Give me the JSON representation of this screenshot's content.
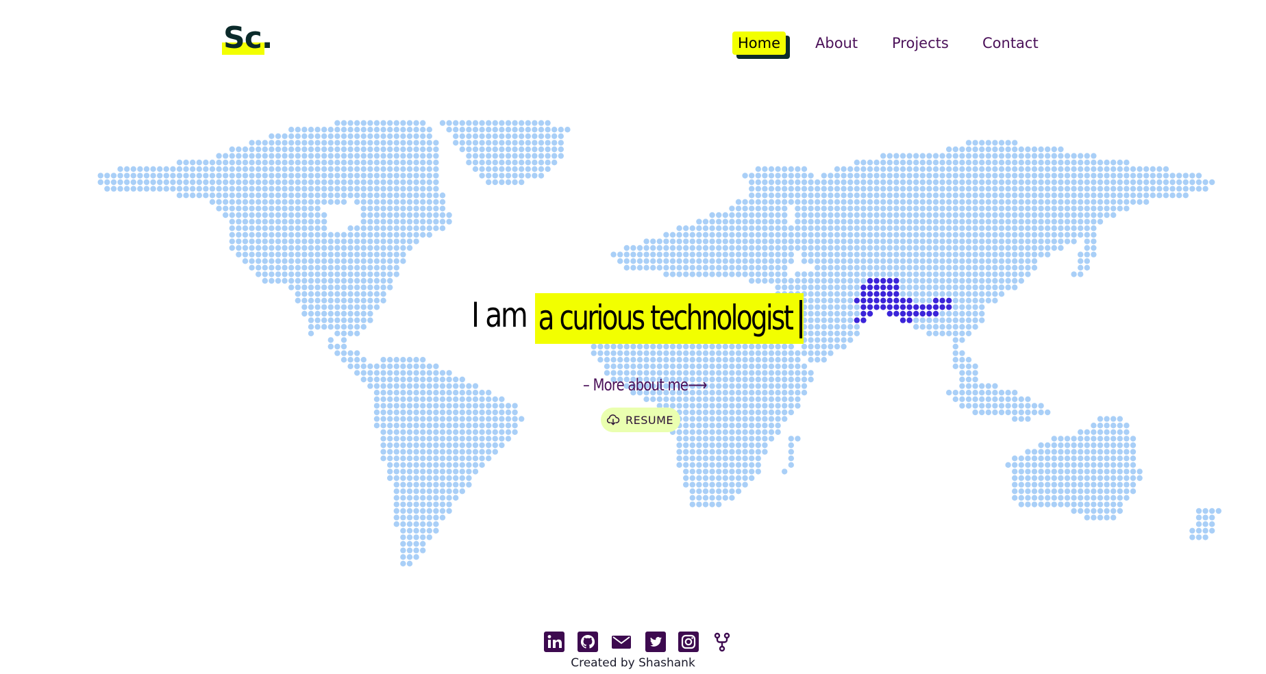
{
  "header": {
    "logo_text": "Sc.",
    "nav": [
      {
        "label": "Home",
        "active": true
      },
      {
        "label": "About",
        "active": false
      },
      {
        "label": "Projects",
        "active": false
      },
      {
        "label": "Contact",
        "active": false
      }
    ]
  },
  "hero": {
    "prefix": "I am",
    "phrase": "a curious technologist",
    "more_link": "– More about me⟶",
    "resume_label": "RESUME",
    "resume_icon": "cloud-download-icon"
  },
  "map": {
    "land_dot_color": "#a9cff7",
    "highlight_dot_color": "#3b24d9",
    "highlight_region": "India"
  },
  "social_links": [
    {
      "name": "linkedin-icon"
    },
    {
      "name": "github-icon"
    },
    {
      "name": "email-icon"
    },
    {
      "name": "twitter-icon"
    },
    {
      "name": "instagram-icon"
    },
    {
      "name": "fork-icon"
    }
  ],
  "footer": {
    "credit": "Created by Shashank"
  },
  "colors": {
    "accent_yellow": "#f2ff00",
    "nav_text": "#4a1058",
    "dark_teal": "#0b2a2a",
    "resume_bg": "#eaffb0",
    "icon_purple": "#3d0a4f"
  }
}
